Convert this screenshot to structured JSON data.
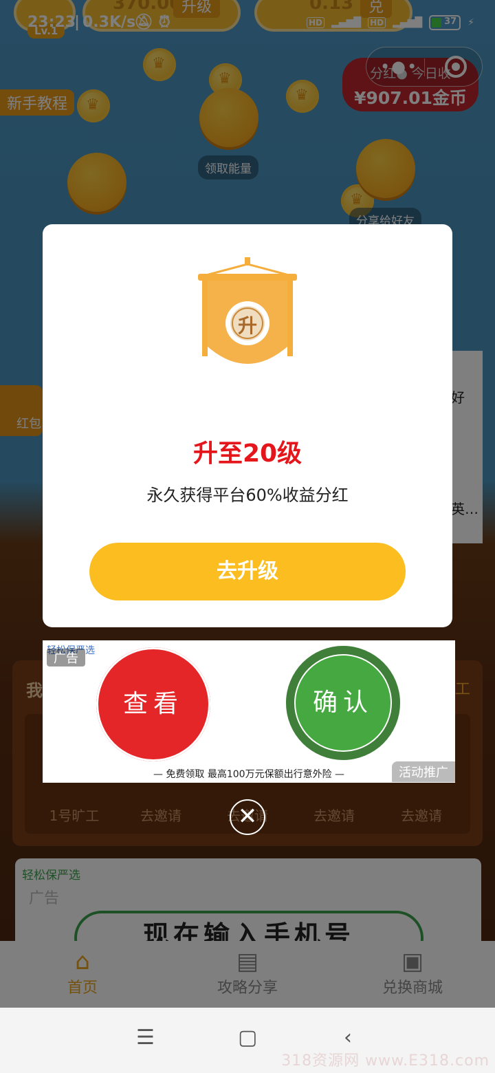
{
  "status_bar": {
    "time": "23:23",
    "speed": "0.3K/s",
    "hd1": "HD",
    "net1": "4G",
    "hd2": "HD",
    "net2": "4G",
    "battery": "37"
  },
  "game": {
    "level": "Lv.1",
    "coins_value": "370.00",
    "upgrade_label": "升级",
    "money_value": "0.13",
    "exchange_label": "兑",
    "dividend_label": "分红● 今日收",
    "dividend_amount": "¥907.01金币",
    "tutorial_label": "新手教程",
    "collect_energy_label": "领取能量",
    "share_label": "分享给好友",
    "red_packet_label": "红包",
    "side_text1": "好",
    "side_text2": "英…"
  },
  "workers": {
    "title_left": "我",
    "title_right": "工",
    "slots": [
      "1号旷工",
      "去邀请",
      "去邀请",
      "去邀请",
      "去邀请"
    ]
  },
  "ad2": {
    "brand": "轻松保严选",
    "ad_tag": "广告",
    "text": "现在输入手机号"
  },
  "bottom_nav": [
    {
      "icon": "home-icon",
      "label": "首页"
    },
    {
      "icon": "book-icon",
      "label": "攻略分享"
    },
    {
      "icon": "shop-icon",
      "label": "兑换商城"
    }
  ],
  "dialog": {
    "badge_char": "升",
    "title": "升至20级",
    "desc": "永久获得平台60%收益分红",
    "button": "去升级"
  },
  "ad": {
    "brand": "轻松保严选",
    "ad_tag": "广告",
    "view_button": "查看",
    "confirm_button": "确认",
    "footer": "—  免费领取    最高100万元保额出行意外险  —",
    "promo_tag": "活动推广"
  },
  "watermark": "318资源网 www.E318.com",
  "colors": {
    "accent": "#fbbd1f",
    "title_red": "#e4161b",
    "view_red": "#e52628",
    "confirm_green": "#3f9a3a"
  }
}
